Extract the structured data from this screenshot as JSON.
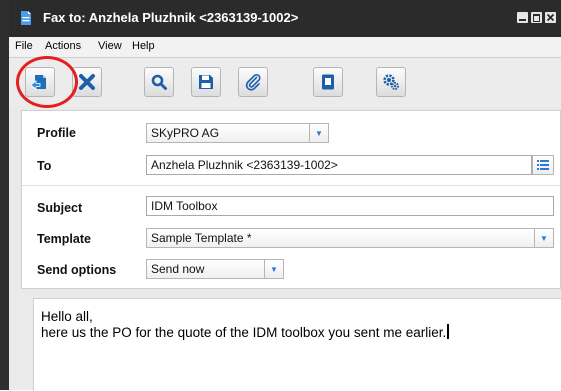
{
  "window": {
    "title": "Fax to: Anzhela Pluzhnik <2363139-1002>",
    "icon": "fax-document-icon",
    "controls": [
      "minimize-icon",
      "maximize-icon",
      "close-icon"
    ]
  },
  "menu": {
    "file": "File",
    "actions": "Actions",
    "view": "View",
    "help": "Help"
  },
  "toolbar": {
    "buttons": [
      "send-icon",
      "delete-icon",
      "search-icon",
      "save-icon",
      "attach-icon",
      "address-book-icon",
      "settings-icon"
    ],
    "highlighted": "send-icon"
  },
  "form": {
    "profile_label": "Profile",
    "profile_value": "SKyPRO AG",
    "to_label": "To",
    "to_value": "Anzhela Pluzhnik <2363139-1002>",
    "subject_label": "Subject",
    "subject_value": "IDM Toolbox",
    "template_label": "Template",
    "template_value": "Sample Template *",
    "send_options_label": "Send options",
    "send_options_value": "Send now"
  },
  "body": {
    "line1": "Hello all,",
    "line2": "here us the PO for the quote of the IDM toolbox you sent me earlier."
  },
  "colors": {
    "titlebar": "#2b2b2b",
    "accent": "#2a7ad5",
    "highlight": "#e51f1f"
  }
}
